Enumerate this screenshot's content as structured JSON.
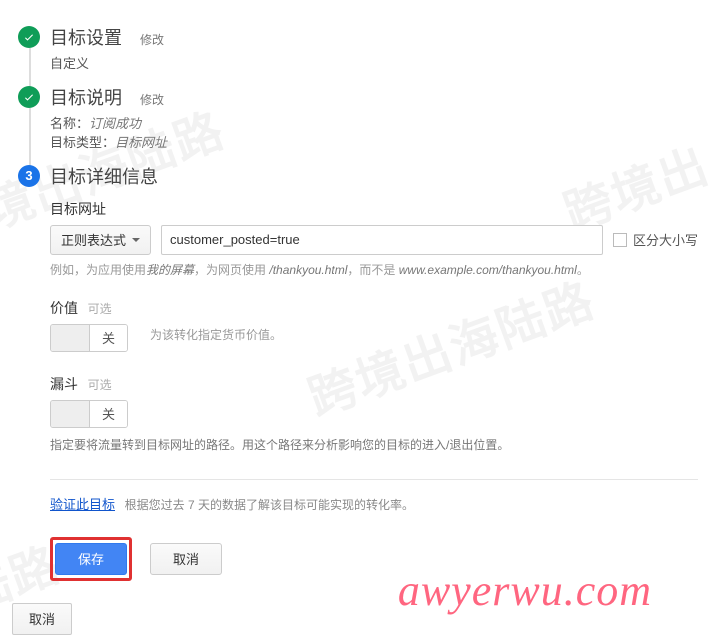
{
  "steps": {
    "edit_label": "修改",
    "s1": {
      "title": "目标设置",
      "subtitle": "自定义"
    },
    "s2": {
      "title": "目标说明",
      "name_label": "名称：",
      "name_value": "订阅成功",
      "type_label": "目标类型：",
      "type_value": "目标网址"
    },
    "s3": {
      "title": "目标详细信息",
      "number": "3"
    }
  },
  "url_section": {
    "label": "目标网址",
    "match_mode": "正则表达式",
    "input_value": "customer_posted=true",
    "case_label": "区分大小写",
    "hint_prefix": "例如，为应用使用",
    "hint_italic1": "我的屏幕",
    "hint_mid": "，为网页使用 ",
    "hint_italic2": "/thankyou.html",
    "hint_mid2": "，而不是 ",
    "hint_italic3": "www.example.com/thankyou.html",
    "hint_end": "。"
  },
  "value_section": {
    "label": "价值",
    "optional": "可选",
    "off": "关",
    "hint": "为该转化指定货币价值。"
  },
  "funnel_section": {
    "label": "漏斗",
    "optional": "可选",
    "off": "关",
    "hint": "指定要将流量转到目标网址的路径。用这个路径来分析影响您的目标的进入/退出位置。"
  },
  "verify": {
    "link": "验证此目标",
    "hint": "根据您过去 7 天的数据了解该目标可能实现的转化率。"
  },
  "buttons": {
    "save": "保存",
    "cancel": "取消",
    "bottom_cancel": "取消"
  }
}
